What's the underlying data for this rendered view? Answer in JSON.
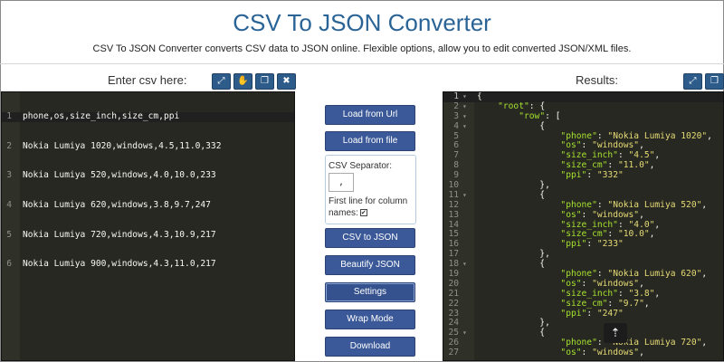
{
  "page": {
    "title": "CSV To JSON Converter",
    "subtitle": "CSV To JSON Converter converts CSV data to JSON online. Flexible options, allow you to edit converted JSON/XML files."
  },
  "left_panel": {
    "title": "Enter csv here:",
    "tools": [
      {
        "icon": "expand-icon",
        "glyph": "⤢"
      },
      {
        "icon": "hand-icon",
        "glyph": "✋"
      },
      {
        "icon": "copy-icon",
        "glyph": "❐"
      },
      {
        "icon": "clear-icon",
        "glyph": "✖"
      }
    ],
    "lines": [
      "phone,os,size_inch,size_cm,ppi",
      "Nokia Lumiya 1020,windows,4.5,11.0,332",
      "Nokia Lumiya 520,windows,4.0,10.0,233",
      "Nokia Lumiya 620,windows,3.8,9.7,247",
      "Nokia Lumiya 720,windows,4.3,10.9,217",
      "Nokia Lumiya 900,windows,4.3,11.0,217"
    ]
  },
  "right_panel": {
    "title": "Results:",
    "tools": [
      {
        "icon": "expand-icon",
        "glyph": "⤢"
      },
      {
        "icon": "copy-icon",
        "glyph": "❐"
      }
    ]
  },
  "controls": {
    "load_url": "Load from Url",
    "load_file": "Load from file",
    "separator_label": "CSV Separator:",
    "separator_value": ",",
    "first_line_label": "First line for column names:",
    "first_line_checked": true,
    "csv_to_json": "CSV to JSON",
    "beautify": "Beautify JSON",
    "settings": "Settings",
    "wrap": "Wrap Mode",
    "download": "Download"
  },
  "scroll_top_icon": "scroll-top-icon",
  "colors": {
    "title": "#2a6496",
    "editor_bg": "#272822",
    "key": "#a6e22e",
    "string": "#e6db74",
    "button": "#3b5998"
  },
  "json_output": [
    {
      "n": "1",
      "fold": true,
      "t": [
        [
          "p",
          "{"
        ]
      ]
    },
    {
      "n": "2",
      "fold": true,
      "t": [
        [
          "p",
          "    "
        ],
        [
          "k",
          "\"root\""
        ],
        [
          "p",
          ": {"
        ]
      ]
    },
    {
      "n": "3",
      "fold": true,
      "t": [
        [
          "p",
          "        "
        ],
        [
          "k",
          "\"row\""
        ],
        [
          "p",
          ": ["
        ]
      ]
    },
    {
      "n": "4",
      "fold": true,
      "t": [
        [
          "p",
          "            {"
        ]
      ]
    },
    {
      "n": "5",
      "t": [
        [
          "p",
          "                "
        ],
        [
          "k",
          "\"phone\""
        ],
        [
          "p",
          ": "
        ],
        [
          "s",
          "\"Nokia Lumiya 1020\""
        ],
        [
          "p",
          ","
        ]
      ]
    },
    {
      "n": "6",
      "t": [
        [
          "p",
          "                "
        ],
        [
          "k",
          "\"os\""
        ],
        [
          "p",
          ": "
        ],
        [
          "s",
          "\"windows\""
        ],
        [
          "p",
          ","
        ]
      ]
    },
    {
      "n": "7",
      "t": [
        [
          "p",
          "                "
        ],
        [
          "k",
          "\"size_inch\""
        ],
        [
          "p",
          ": "
        ],
        [
          "s",
          "\"4.5\""
        ],
        [
          "p",
          ","
        ]
      ]
    },
    {
      "n": "8",
      "t": [
        [
          "p",
          "                "
        ],
        [
          "k",
          "\"size_cm\""
        ],
        [
          "p",
          ": "
        ],
        [
          "s",
          "\"11.0\""
        ],
        [
          "p",
          ","
        ]
      ]
    },
    {
      "n": "9",
      "t": [
        [
          "p",
          "                "
        ],
        [
          "k",
          "\"ppi\""
        ],
        [
          "p",
          ": "
        ],
        [
          "s",
          "\"332\""
        ]
      ]
    },
    {
      "n": "10",
      "t": [
        [
          "p",
          "            },"
        ]
      ]
    },
    {
      "n": "11",
      "fold": true,
      "t": [
        [
          "p",
          "            {"
        ]
      ]
    },
    {
      "n": "12",
      "t": [
        [
          "p",
          "                "
        ],
        [
          "k",
          "\"phone\""
        ],
        [
          "p",
          ": "
        ],
        [
          "s",
          "\"Nokia Lumiya 520\""
        ],
        [
          "p",
          ","
        ]
      ]
    },
    {
      "n": "13",
      "t": [
        [
          "p",
          "                "
        ],
        [
          "k",
          "\"os\""
        ],
        [
          "p",
          ": "
        ],
        [
          "s",
          "\"windows\""
        ],
        [
          "p",
          ","
        ]
      ]
    },
    {
      "n": "14",
      "t": [
        [
          "p",
          "                "
        ],
        [
          "k",
          "\"size_inch\""
        ],
        [
          "p",
          ": "
        ],
        [
          "s",
          "\"4.0\""
        ],
        [
          "p",
          ","
        ]
      ]
    },
    {
      "n": "15",
      "t": [
        [
          "p",
          "                "
        ],
        [
          "k",
          "\"size_cm\""
        ],
        [
          "p",
          ": "
        ],
        [
          "s",
          "\"10.0\""
        ],
        [
          "p",
          ","
        ]
      ]
    },
    {
      "n": "16",
      "t": [
        [
          "p",
          "                "
        ],
        [
          "k",
          "\"ppi\""
        ],
        [
          "p",
          ": "
        ],
        [
          "s",
          "\"233\""
        ]
      ]
    },
    {
      "n": "17",
      "t": [
        [
          "p",
          "            },"
        ]
      ]
    },
    {
      "n": "18",
      "fold": true,
      "t": [
        [
          "p",
          "            {"
        ]
      ]
    },
    {
      "n": "19",
      "t": [
        [
          "p",
          "                "
        ],
        [
          "k",
          "\"phone\""
        ],
        [
          "p",
          ": "
        ],
        [
          "s",
          "\"Nokia Lumiya 620\""
        ],
        [
          "p",
          ","
        ]
      ]
    },
    {
      "n": "20",
      "t": [
        [
          "p",
          "                "
        ],
        [
          "k",
          "\"os\""
        ],
        [
          "p",
          ": "
        ],
        [
          "s",
          "\"windows\""
        ],
        [
          "p",
          ","
        ]
      ]
    },
    {
      "n": "21",
      "t": [
        [
          "p",
          "                "
        ],
        [
          "k",
          "\"size_inch\""
        ],
        [
          "p",
          ": "
        ],
        [
          "s",
          "\"3.8\""
        ],
        [
          "p",
          ","
        ]
      ]
    },
    {
      "n": "22",
      "t": [
        [
          "p",
          "                "
        ],
        [
          "k",
          "\"size_cm\""
        ],
        [
          "p",
          ": "
        ],
        [
          "s",
          "\"9.7\""
        ],
        [
          "p",
          ","
        ]
      ]
    },
    {
      "n": "23",
      "t": [
        [
          "p",
          "                "
        ],
        [
          "k",
          "\"ppi\""
        ],
        [
          "p",
          ": "
        ],
        [
          "s",
          "\"247\""
        ]
      ]
    },
    {
      "n": "24",
      "t": [
        [
          "p",
          "            },"
        ]
      ]
    },
    {
      "n": "25",
      "fold": true,
      "t": [
        [
          "p",
          "            {"
        ]
      ]
    },
    {
      "n": "26",
      "t": [
        [
          "p",
          "                "
        ],
        [
          "k",
          "\"phone\""
        ],
        [
          "p",
          ": "
        ],
        [
          "s",
          "\"Nokia Lumiya 720\""
        ],
        [
          "p",
          ","
        ]
      ]
    },
    {
      "n": "27",
      "t": [
        [
          "p",
          "                "
        ],
        [
          "k",
          "\"os\""
        ],
        [
          "p",
          ": "
        ],
        [
          "s",
          "\"windows\""
        ],
        [
          "p",
          ","
        ]
      ]
    }
  ]
}
